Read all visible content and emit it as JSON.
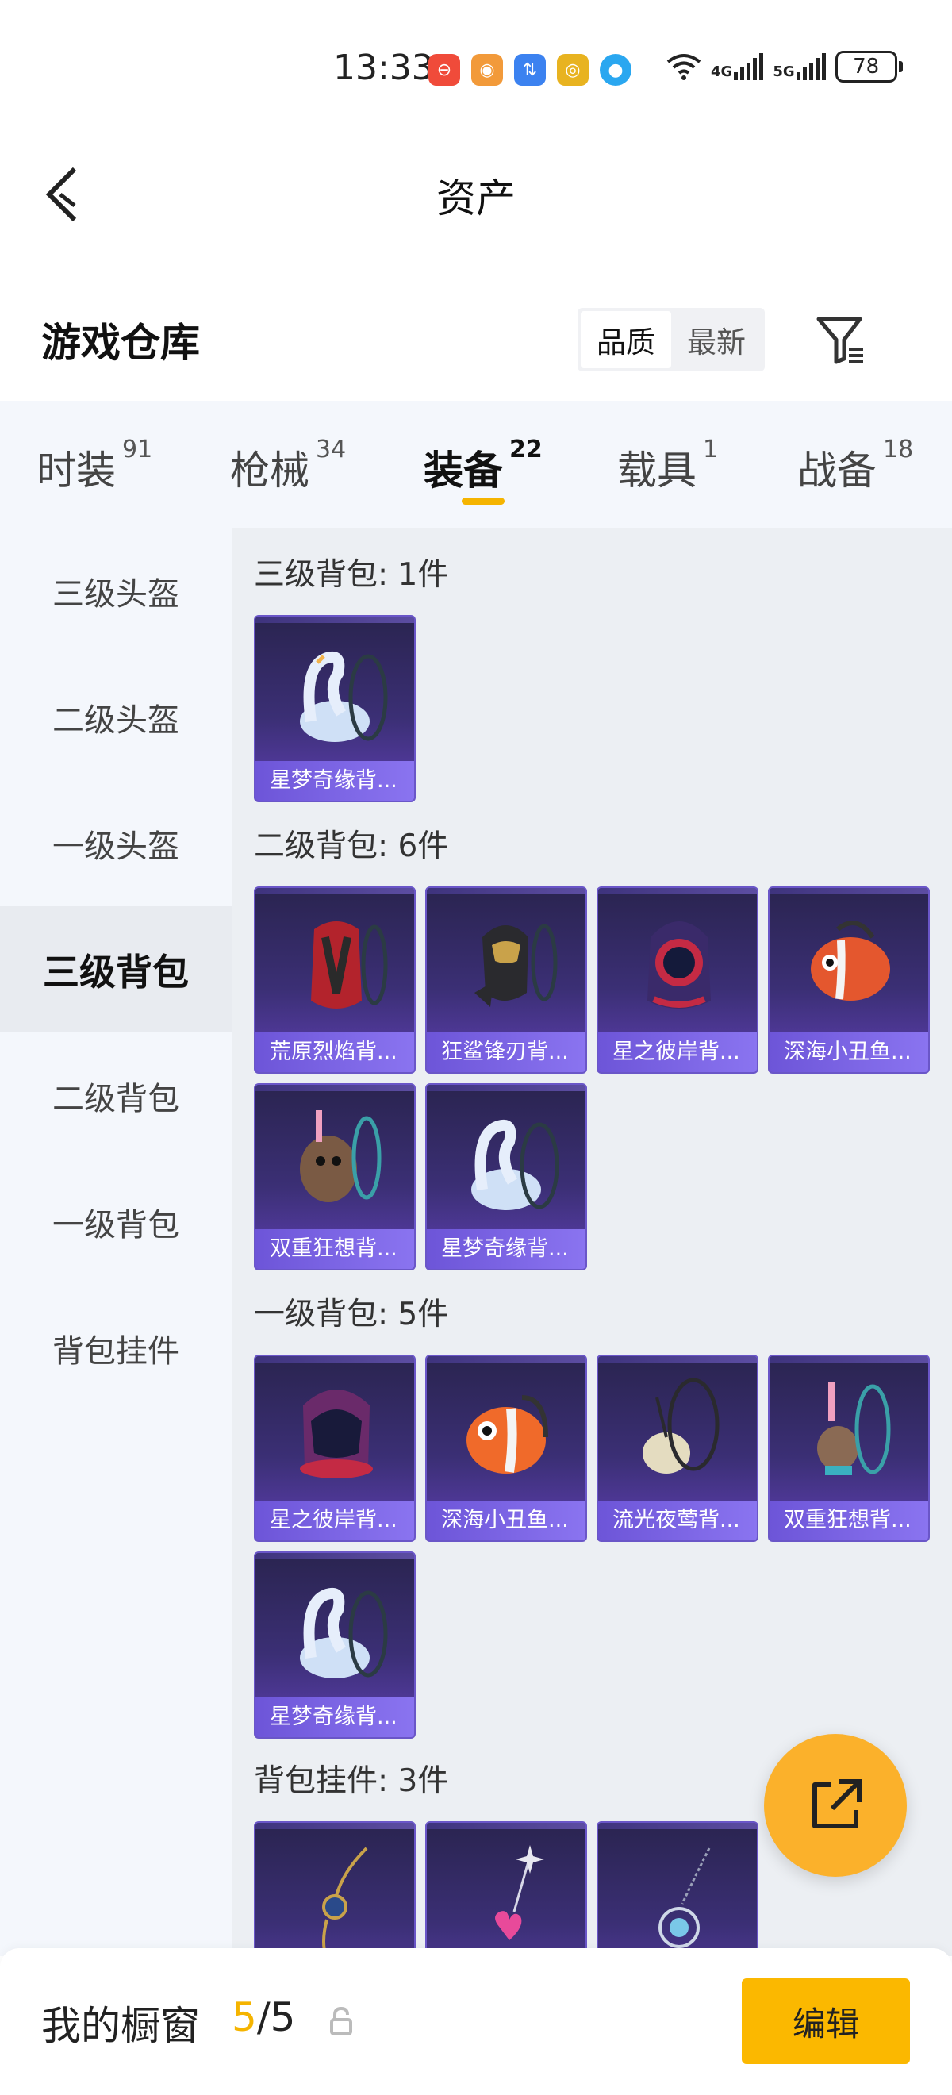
{
  "status_bar": {
    "time": "13:33",
    "network_4g": "4G",
    "network_5g": "5G",
    "battery": "78",
    "notification_icons": [
      {
        "icon": "red-app-icon",
        "color": "#f04b3a"
      },
      {
        "icon": "orange-app-icon",
        "color": "#f29a3a"
      },
      {
        "icon": "blue-app-icon",
        "color": "#3c82f0"
      },
      {
        "icon": "yellow-app-icon",
        "color": "#e8b320"
      },
      {
        "icon": "chat-app-icon",
        "color": "#2aa7f0"
      }
    ]
  },
  "header": {
    "title": "资产"
  },
  "warehouse": {
    "title": "游戏仓库",
    "sort_quality": "品质",
    "sort_latest": "最新"
  },
  "tabs": [
    {
      "label": "时装",
      "count": "91"
    },
    {
      "label": "枪械",
      "count": "34"
    },
    {
      "label": "装备",
      "count": "22"
    },
    {
      "label": "载具",
      "count": "1"
    },
    {
      "label": "战备",
      "count": "18"
    }
  ],
  "sidebar": {
    "items": [
      "三级头盔",
      "二级头盔",
      "一级头盔",
      "三级背包",
      "二级背包",
      "一级背包",
      "背包挂件"
    ]
  },
  "sections": [
    {
      "title": "三级背包: 1件",
      "items": [
        "星梦奇缘背..."
      ]
    },
    {
      "title": "二级背包: 6件",
      "items": [
        "荒原烈焰背...",
        "狂鲨锋刃背...",
        "星之彼岸背...",
        "深海小丑鱼...",
        "双重狂想背...",
        "星梦奇缘背..."
      ]
    },
    {
      "title": "一级背包: 5件",
      "items": [
        "星之彼岸背...",
        "深海小丑鱼...",
        "流光夜莺背...",
        "双重狂想背...",
        "星梦奇缘背..."
      ]
    },
    {
      "title": "背包挂件: 3件",
      "items": [
        "",
        "",
        ""
      ]
    }
  ],
  "bottom_bar": {
    "showcase_label": "我的橱窗",
    "showcase_current": "5",
    "showcase_total": "/5",
    "edit_label": "编辑"
  },
  "colors": {
    "accent": "#f5b400",
    "fab": "#fbb12b",
    "card_label": "#7a63e6"
  }
}
